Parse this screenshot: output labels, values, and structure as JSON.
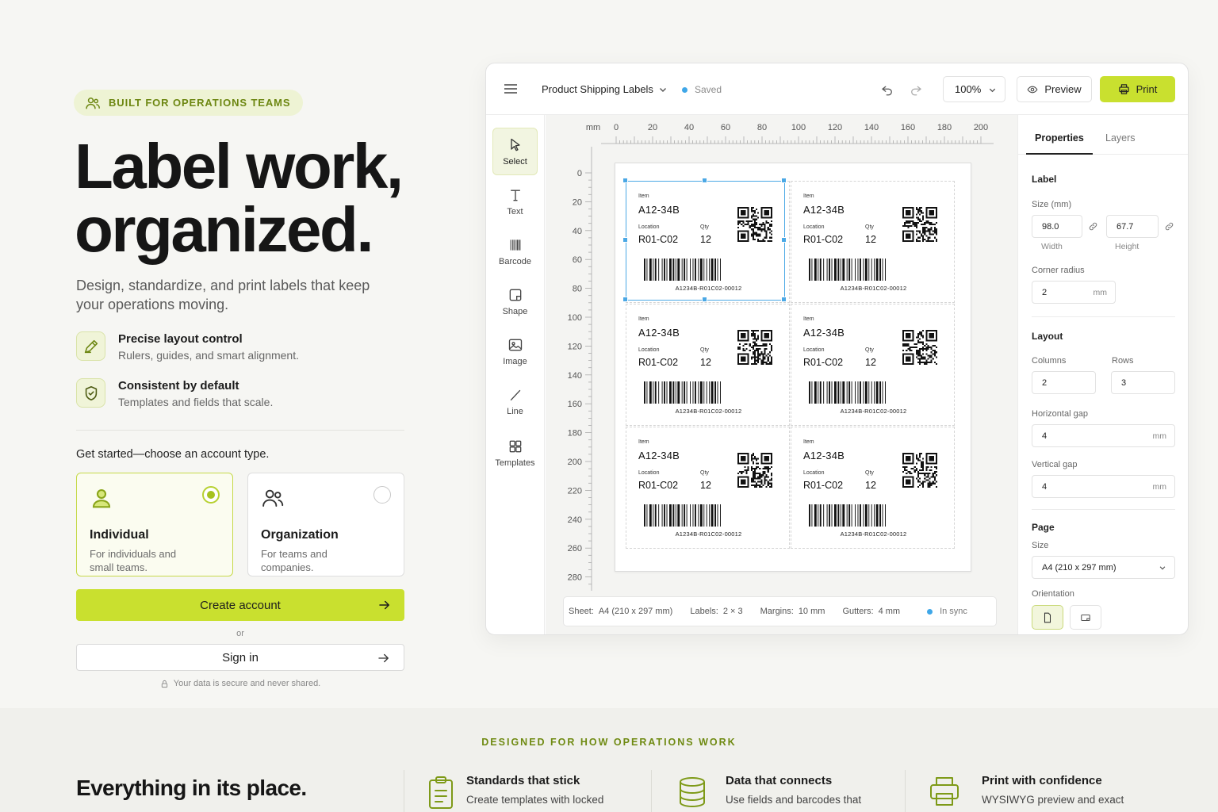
{
  "hero": {
    "badge": "BUILT FOR OPERATIONS TEAMS",
    "title_line1": "Label work,",
    "title_line2": "organized.",
    "subtitle": "Design, standardize, and print labels that keep your operations moving.",
    "features": [
      {
        "title": "Precise layout control",
        "desc": "Rulers, guides, and smart alignment.",
        "icon": "ruler-pencil-icon"
      },
      {
        "title": "Consistent by default",
        "desc": "Templates and fields that scale.",
        "icon": "shield-check-icon"
      }
    ],
    "choose_prompt": "Get started—choose an account type.",
    "accounts": [
      {
        "name": "Individual",
        "desc": "For individuals and small teams.",
        "selected": true,
        "icon": "user-icon"
      },
      {
        "name": "Organization",
        "desc": "For teams and companies.",
        "selected": false,
        "icon": "users-icon"
      }
    ],
    "create_label": "Create account",
    "or_label": "or",
    "signin_label": "Sign in",
    "secure_note": "Your data is secure and never shared."
  },
  "app": {
    "doc_title": "Product Shipping Labels",
    "save_status": "Saved",
    "zoom": "100%",
    "preview_label": "Preview",
    "print_label": "Print",
    "tools": [
      {
        "label": "Select",
        "icon": "cursor-icon",
        "active": true
      },
      {
        "label": "Text",
        "icon": "text-icon",
        "active": false
      },
      {
        "label": "Barcode",
        "icon": "barcode-icon",
        "active": false
      },
      {
        "label": "Shape",
        "icon": "shape-icon",
        "active": false
      },
      {
        "label": "Image",
        "icon": "image-icon",
        "active": false
      },
      {
        "label": "Line",
        "icon": "line-icon",
        "active": false
      },
      {
        "label": "Templates",
        "icon": "grid-icon",
        "active": false
      }
    ],
    "ruler": {
      "unit": "mm",
      "top_ticks": [
        "0",
        "20",
        "40",
        "60",
        "80",
        "100",
        "120",
        "140",
        "160",
        "180",
        "200"
      ],
      "left_ticks": [
        "0",
        "20",
        "40",
        "60",
        "80",
        "100",
        "120",
        "140",
        "160",
        "180",
        "200",
        "220",
        "240",
        "260",
        "280"
      ]
    },
    "label_template": {
      "item_key": "Item",
      "item_value": "A12-34B",
      "location_key": "Location",
      "location_value": "R01-C02",
      "qty_key": "Qty",
      "qty_value": "12",
      "barcode_text": "A1234B-R01C02-00012"
    },
    "status": {
      "sheet_key": "Sheet:",
      "sheet_value": "A4 (210 x 297 mm)",
      "labels_key": "Labels:",
      "labels_value": "2 × 3",
      "margins_key": "Margins:",
      "margins_value": "10 mm",
      "gutters_key": "Gutters:",
      "gutters_value": "4 mm",
      "sync": "In sync"
    },
    "panel": {
      "tab_properties": "Properties",
      "tab_layers": "Layers",
      "label_section": "Label",
      "size_label": "Size (mm)",
      "width_value": "98.0",
      "width_caption": "Width",
      "height_value": "67.7",
      "height_caption": "Height",
      "corner_label": "Corner radius",
      "corner_value": "2",
      "corner_unit": "mm",
      "layout_section": "Layout",
      "columns_label": "Columns",
      "columns_value": "2",
      "rows_label": "Rows",
      "rows_value": "3",
      "hgap_label": "Horizontal gap",
      "hgap_value": "4",
      "hgap_unit": "mm",
      "vgap_label": "Vertical gap",
      "vgap_value": "4",
      "vgap_unit": "mm",
      "page_section": "Page",
      "page_size_label": "Size",
      "page_size_value": "A4 (210 x 297 mm)",
      "orientation_label": "Orientation"
    }
  },
  "bottom": {
    "kicker": "DESIGNED FOR HOW OPERATIONS WORK",
    "title": "Everything in its place.",
    "features": [
      {
        "title": "Standards that stick",
        "desc": "Create templates with locked",
        "icon": "clipboard-icon"
      },
      {
        "title": "Data that connects",
        "desc": "Use fields and barcodes that",
        "icon": "database-icon"
      },
      {
        "title": "Print with confidence",
        "desc": "WYSIWYG preview and exact",
        "icon": "printer-icon"
      }
    ]
  },
  "colors": {
    "accent": "#c9e02f",
    "accent_text": "#6d8712",
    "selection": "#4ba8e5"
  }
}
